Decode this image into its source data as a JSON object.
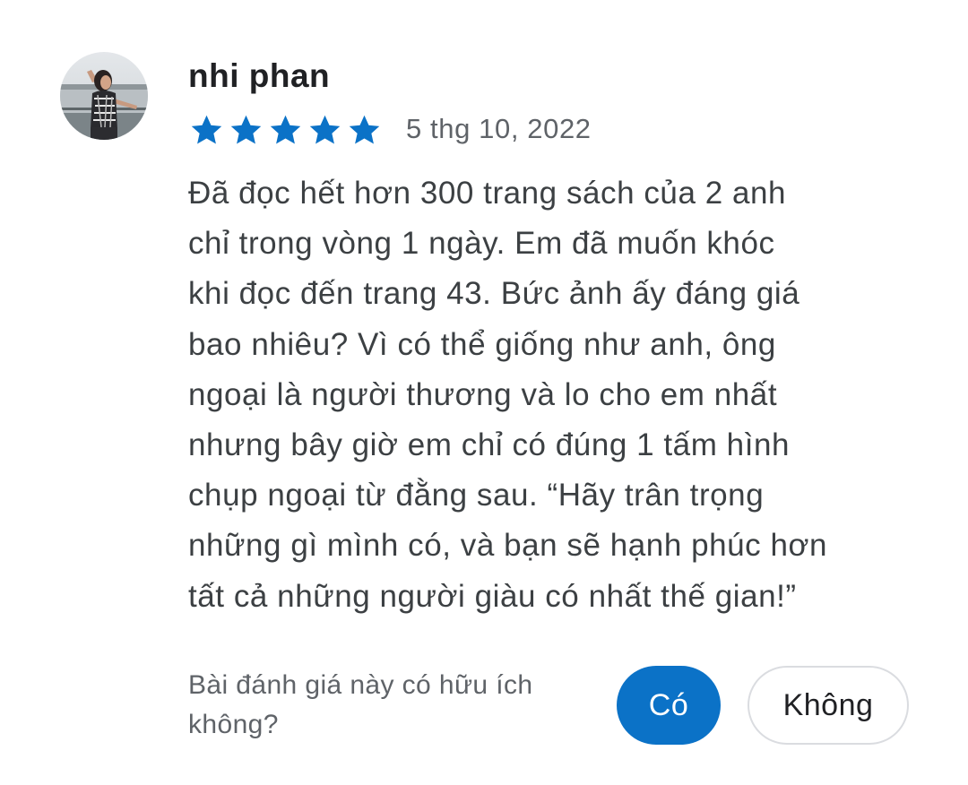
{
  "review": {
    "author": "nhi phan",
    "avatar_icon": "user-photo-avatar",
    "rating": 5,
    "rating_max": 5,
    "star_icon": "star-icon",
    "star_color": "#0b72c7",
    "date": "5 thg 10, 2022",
    "text_lines": [
      "Đã đọc hết hơn 300 trang sách của 2 anh",
      "chỉ trong vòng 1 ngày. Em đã muốn khóc",
      "khi đọc đến trang 43. Bức ảnh ấy đáng giá",
      "bao nhiêu? Vì có thể giống như anh, ông",
      "ngoại là người thương và lo cho em nhất",
      "nhưng bây giờ em chỉ có đúng 1 tấm hình",
      "chụp ngoại từ đằng sau. “Hãy trân trọng",
      "những gì mình có, và bạn sẽ hạnh phúc hơn",
      "tất cả những người giàu có nhất  thế gian!”"
    ]
  },
  "helpful": {
    "question": "Bài đánh giá này có hữu ích không?",
    "yes_label": "Có",
    "no_label": "Không",
    "accent_color": "#0b72c7"
  }
}
